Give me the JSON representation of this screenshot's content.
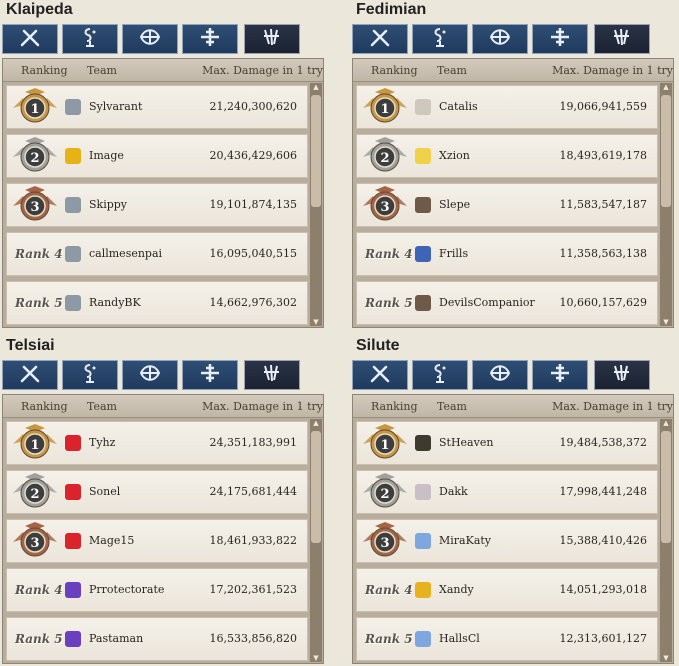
{
  "header": {
    "ranking": "Ranking",
    "team": "Team",
    "damage": "Max. Damage in 1 try"
  },
  "tabs": [
    "swordsman-icon",
    "wizard-icon",
    "archer-icon",
    "cleric-icon",
    "scout-icon"
  ],
  "medal_colors": {
    "gold": "#c7963f",
    "silver": "#9fa0a0",
    "bronze": "#a56445"
  },
  "regions": [
    {
      "name": "Klaipeda",
      "rows": [
        {
          "rank": "1",
          "team": "Sylvarant",
          "damage": "21,240,300,620",
          "icon": "gear-emblem-icon",
          "icon_color": "#8e99a6"
        },
        {
          "rank": "2",
          "team": "Image",
          "damage": "20,436,429,606",
          "icon": "yellow-emblem-icon",
          "icon_color": "#e5b316"
        },
        {
          "rank": "3",
          "team": "Skippy",
          "damage": "19,101,874,135",
          "icon": "gear-emblem-icon",
          "icon_color": "#8e99a6"
        },
        {
          "rank": "Rank 4",
          "team": "callmesenpai",
          "damage": "16,095,040,515",
          "icon": "gear-emblem-icon",
          "icon_color": "#8e99a6"
        },
        {
          "rank": "Rank 5",
          "team": "RandyBK",
          "damage": "14,662,976,302",
          "icon": "gear-emblem-icon",
          "icon_color": "#8e99a6"
        }
      ]
    },
    {
      "name": "Fedimian",
      "rows": [
        {
          "rank": "1",
          "team": "Catalis",
          "damage": "19,066,941,559",
          "icon": "blank-emblem-icon",
          "icon_color": "#cfc8bd"
        },
        {
          "rank": "2",
          "team": "Xzion",
          "damage": "18,493,619,178",
          "icon": "chick-emblem-icon",
          "icon_color": "#f0d24a"
        },
        {
          "rank": "3",
          "team": "Slepe",
          "damage": "11,583,547,187",
          "icon": "character-emblem-icon",
          "icon_color": "#6f5a4a"
        },
        {
          "rank": "Rank 4",
          "team": "Frills",
          "damage": "11,358,563,138",
          "icon": "shield-emblem-icon",
          "icon_color": "#3f63b5"
        },
        {
          "rank": "Rank 5",
          "team": "DevilsCompanior",
          "damage": "10,660,157,629",
          "icon": "character-emblem-icon",
          "icon_color": "#6f5a4a"
        }
      ]
    },
    {
      "name": "Telsiai",
      "rows": [
        {
          "rank": "1",
          "team": "Tyhz",
          "damage": "24,351,183,991",
          "icon": "red-emblem-icon",
          "icon_color": "#d8242a"
        },
        {
          "rank": "2",
          "team": "Sonel",
          "damage": "24,175,681,444",
          "icon": "red-emblem-icon",
          "icon_color": "#d8242a"
        },
        {
          "rank": "3",
          "team": "Mage15",
          "damage": "18,461,933,822",
          "icon": "red-emblem-icon",
          "icon_color": "#d8242a"
        },
        {
          "rank": "Rank 4",
          "team": "Prrotectorate",
          "damage": "17,202,361,523",
          "icon": "purple-emblem-icon",
          "icon_color": "#6a3fc0"
        },
        {
          "rank": "Rank 5",
          "team": "Pastaman",
          "damage": "16,533,856,820",
          "icon": "purple-emblem-icon",
          "icon_color": "#6a3fc0"
        }
      ]
    },
    {
      "name": "Silute",
      "rows": [
        {
          "rank": "1",
          "team": "StHeaven",
          "damage": "19,484,538,372",
          "icon": "dark-emblem-icon",
          "icon_color": "#3f3a2e"
        },
        {
          "rank": "2",
          "team": "Dakk",
          "damage": "17,998,441,248",
          "icon": "skull-emblem-icon",
          "icon_color": "#c9bfc6"
        },
        {
          "rank": "3",
          "team": "MiraKaty",
          "damage": "15,388,410,426",
          "icon": "wings-emblem-icon",
          "icon_color": "#7ea6e0"
        },
        {
          "rank": "Rank 4",
          "team": "Xandy",
          "damage": "14,051,293,018",
          "icon": "p-emblem-icon",
          "icon_color": "#e7b21f"
        },
        {
          "rank": "Rank 5",
          "team": "HallsCl",
          "damage": "12,313,601,127",
          "icon": "wings-emblem-icon",
          "icon_color": "#7ea6e0"
        }
      ]
    }
  ]
}
